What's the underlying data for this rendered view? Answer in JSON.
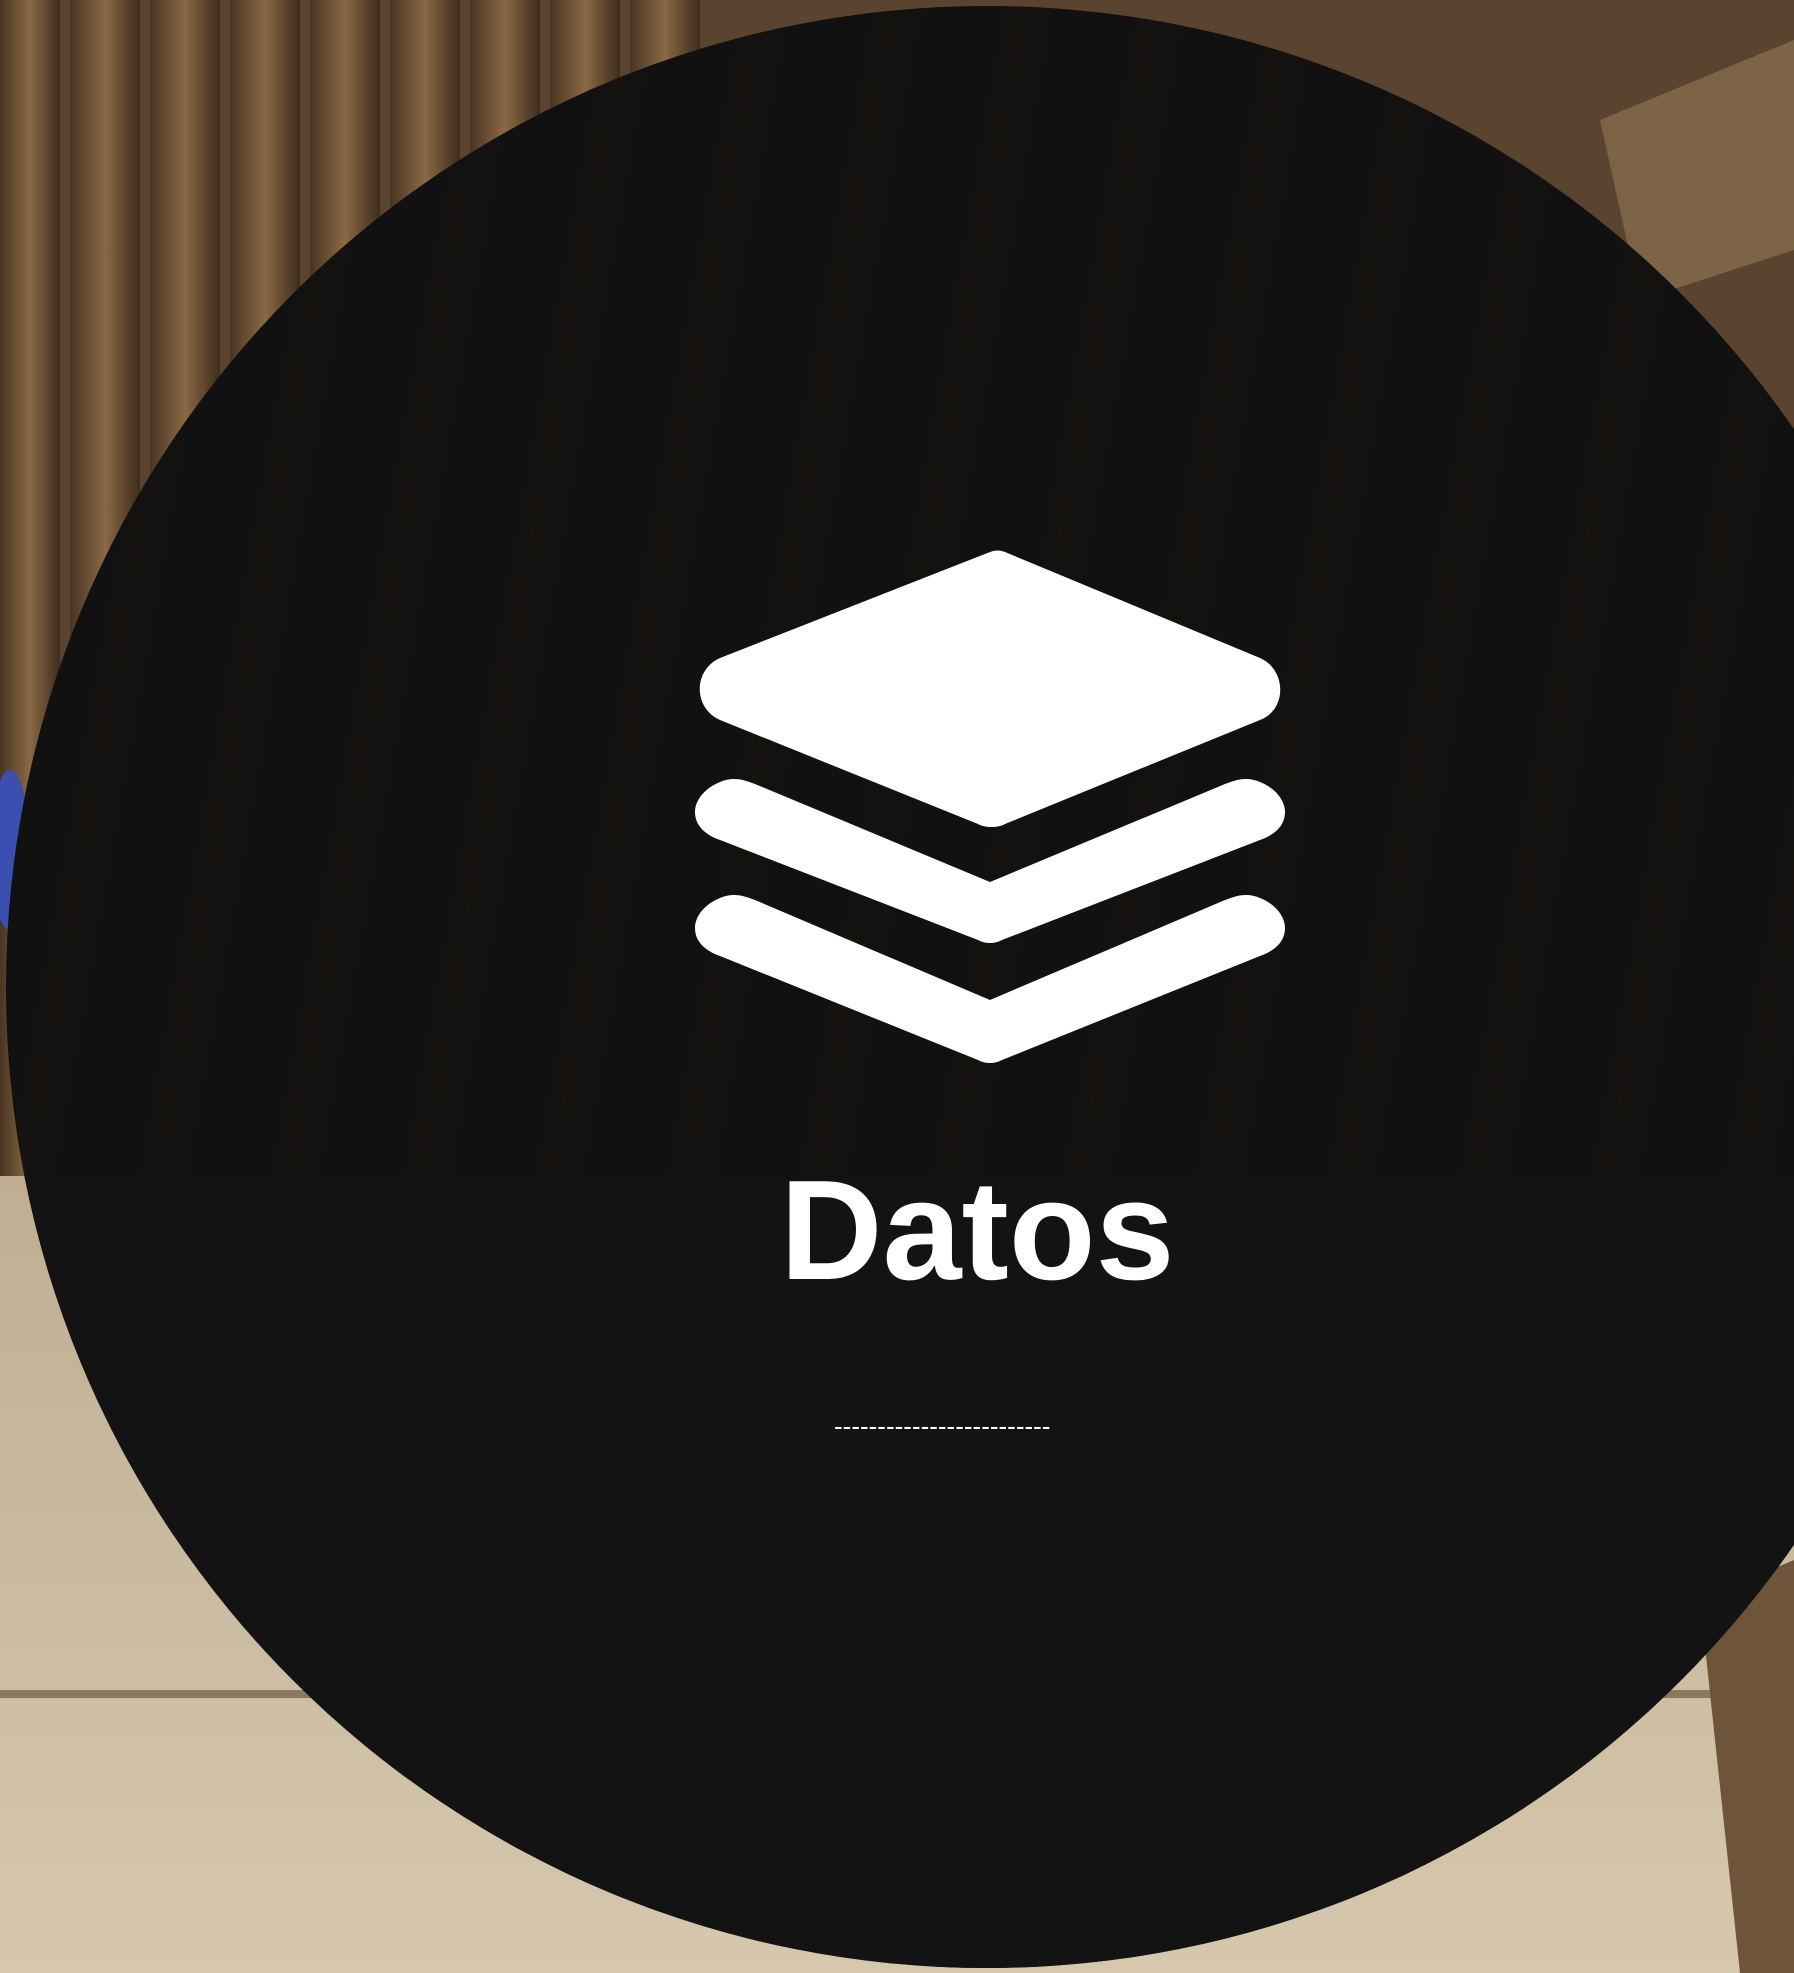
{
  "heading": {
    "title": "Datos",
    "divider": "-------------------------"
  },
  "icon": {
    "name": "layers-icon",
    "color": "#ffffff"
  },
  "colors": {
    "overlay": "#111111",
    "text": "#ffffff",
    "wood": "#6b5236"
  }
}
